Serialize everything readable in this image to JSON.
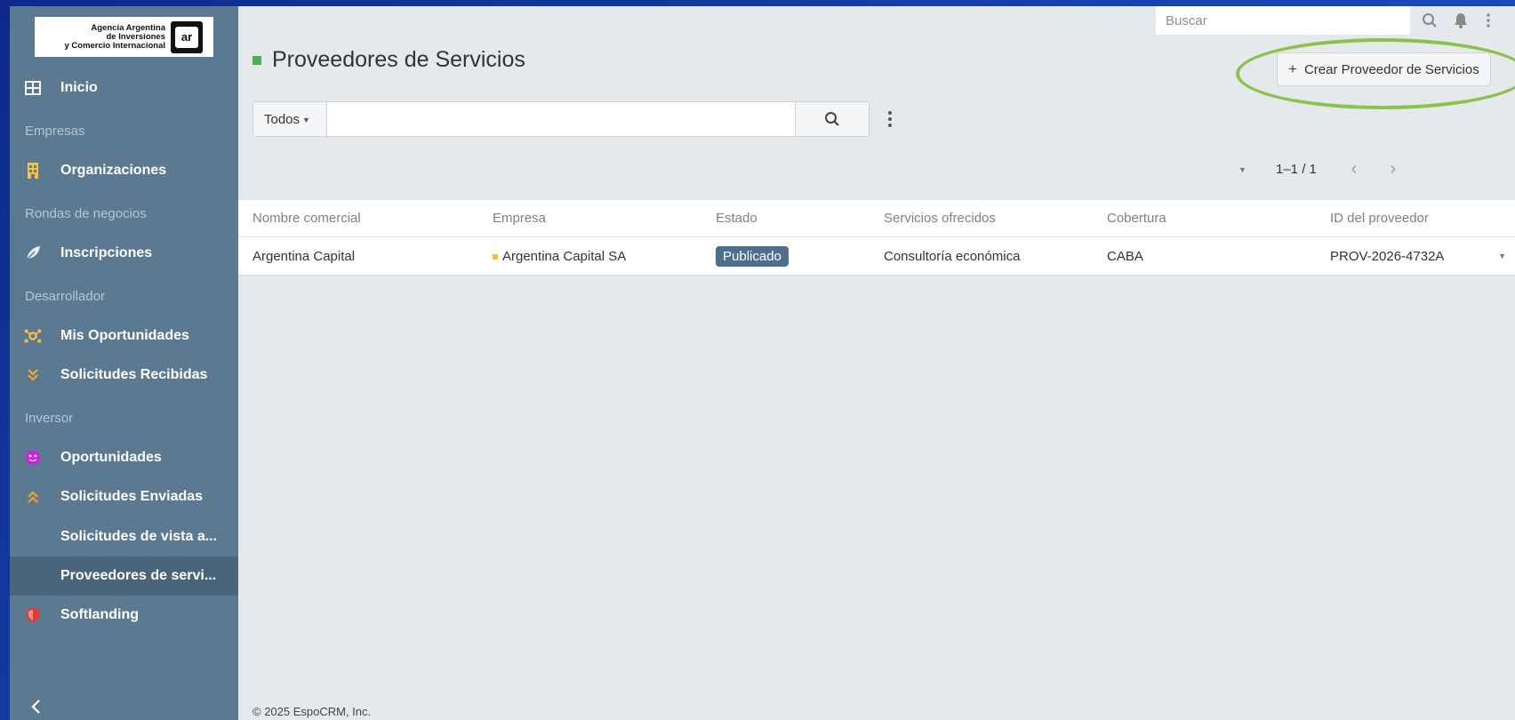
{
  "sidebar": {
    "logo": {
      "line1": "Agencia Argentina",
      "line2": "de Inversiones",
      "line3": "y Comercio Internacional",
      "mark": "ar"
    },
    "items": [
      {
        "id": "inicio",
        "label": "Inicio",
        "icon": "grid-icon",
        "type": "item"
      },
      {
        "id": "sec-empresas",
        "label": "Empresas",
        "type": "section"
      },
      {
        "id": "organizaciones",
        "label": "Organizaciones",
        "icon": "building-icon",
        "type": "item"
      },
      {
        "id": "sec-rondas",
        "label": "Rondas de negocios",
        "type": "section"
      },
      {
        "id": "inscripciones",
        "label": "Inscripciones",
        "icon": "leaf-icon",
        "type": "item"
      },
      {
        "id": "sec-desarrollador",
        "label": "Desarrollador",
        "type": "section"
      },
      {
        "id": "mis-oportunidades",
        "label": "Mis Oportunidades",
        "icon": "network-icon",
        "type": "item"
      },
      {
        "id": "solicitudes-recibidas",
        "label": "Solicitudes Recibidas",
        "icon": "double-chevron-down-icon",
        "type": "item"
      },
      {
        "id": "sec-inversor",
        "label": "Inversor",
        "type": "section"
      },
      {
        "id": "oportunidades",
        "label": "Oportunidades",
        "icon": "emoji-icon",
        "type": "item"
      },
      {
        "id": "solicitudes-enviadas",
        "label": "Solicitudes Enviadas",
        "icon": "double-chevron-up-icon",
        "type": "item"
      },
      {
        "id": "solicitudes-vista",
        "label": "Solicitudes de vista a...",
        "type": "item"
      },
      {
        "id": "proveedores",
        "label": "Proveedores de servi...",
        "type": "item",
        "active": true
      },
      {
        "id": "softlanding",
        "label": "Softlanding",
        "icon": "shield-icon",
        "type": "item"
      }
    ]
  },
  "topbar": {
    "search_placeholder": "Buscar"
  },
  "page": {
    "title": "Proveedores de Servicios",
    "create_button": "Crear Proveedor de Servicios",
    "filter_select": "Todos",
    "pagination": "1–1 / 1"
  },
  "table": {
    "columns": [
      "Nombre comercial",
      "Empresa",
      "Estado",
      "Servicios ofrecidos",
      "Cobertura",
      "ID del proveedor"
    ],
    "rows": [
      {
        "nombre": "Argentina Capital",
        "empresa": "Argentina Capital SA",
        "estado": "Publicado",
        "servicios": "Consultoría económica",
        "cobertura": "CABA",
        "id": "PROV-2026-4732A"
      }
    ]
  },
  "footer": {
    "text": "© 2025 EspoCRM, Inc."
  },
  "colors": {
    "accent": "#4cb050",
    "sidebar": "#5b7a91",
    "badge": "#4e6e8e",
    "highlight": "#8bc34a",
    "link": "#3b7ebd"
  }
}
